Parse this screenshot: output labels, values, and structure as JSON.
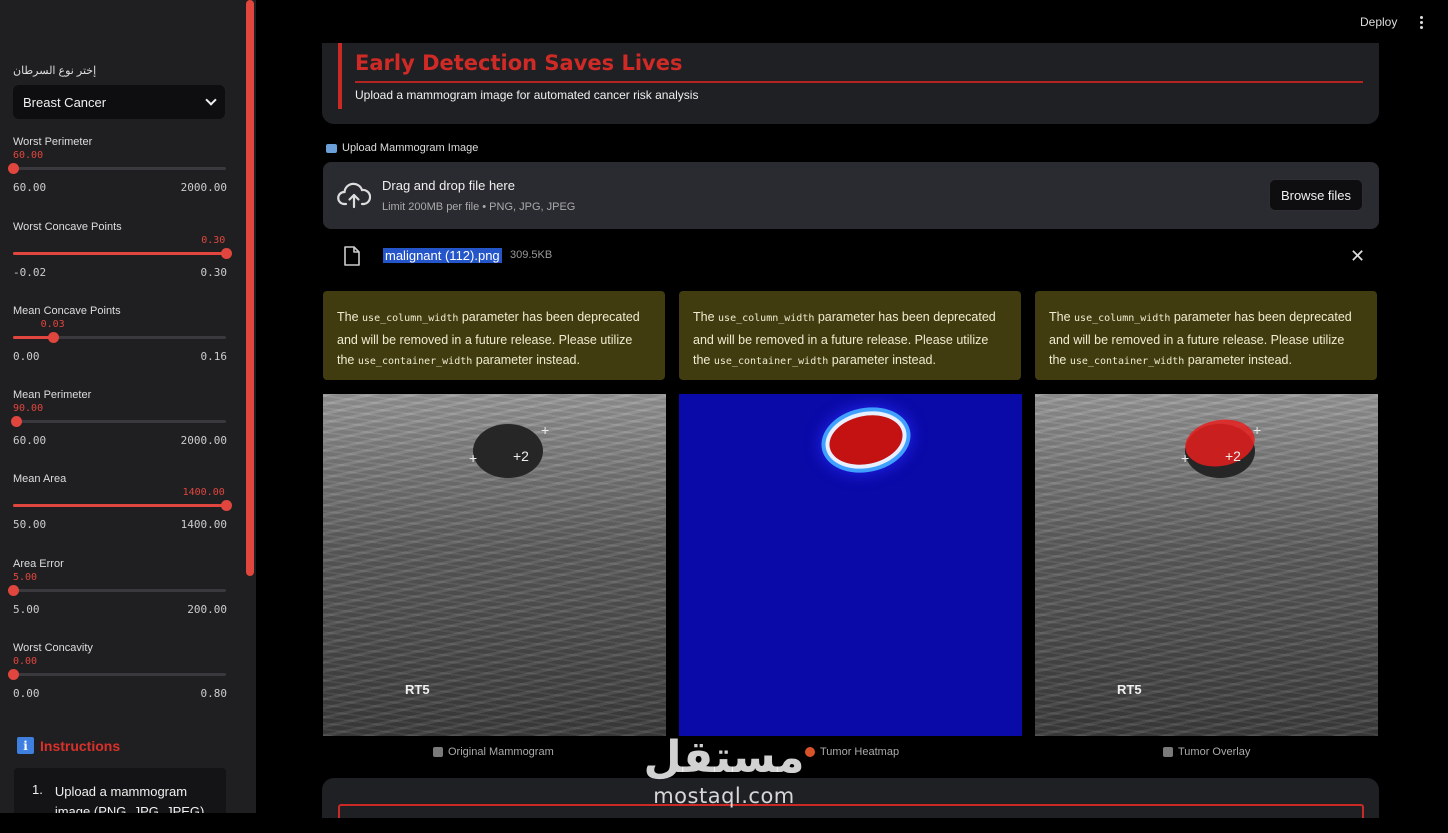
{
  "topbar": {
    "deploy_label": "Deploy"
  },
  "sidebar": {
    "cancer_type_label": "إختر نوع السرطان",
    "cancer_type_selected": "Breast Cancer",
    "sliders": [
      {
        "label": "Worst Perimeter",
        "value": "60.00",
        "min": "60.00",
        "max": "2000.00",
        "fraction": 0.0
      },
      {
        "label": "Worst Concave Points",
        "value": "0.30",
        "min": "-0.02",
        "max": "0.30",
        "fraction": 1.0
      },
      {
        "label": "Mean Concave Points",
        "value": "0.03",
        "min": "0.00",
        "max": "0.16",
        "fraction": 0.19
      },
      {
        "label": "Mean Perimeter",
        "value": "90.00",
        "min": "60.00",
        "max": "2000.00",
        "fraction": 0.015
      },
      {
        "label": "Mean Area",
        "value": "1400.00",
        "min": "50.00",
        "max": "1400.00",
        "fraction": 1.0
      },
      {
        "label": "Area Error",
        "value": "5.00",
        "min": "5.00",
        "max": "200.00",
        "fraction": 0.0
      },
      {
        "label": "Worst Concavity",
        "value": "0.00",
        "min": "0.00",
        "max": "0.80",
        "fraction": 0.0
      }
    ],
    "instructions_title": "Instructions",
    "instructions_first_num": "1.",
    "instructions_first_item": "Upload a mammogram image (PNG, JPG, JPEG)"
  },
  "hero": {
    "title": "Early Detection Saves Lives",
    "subtitle": "Upload a mammogram image for automated cancer risk analysis"
  },
  "uploader": {
    "label": "Upload Mammogram Image",
    "drag_text": "Drag and drop file here",
    "limit_text": "Limit 200MB per file • PNG, JPG, JPEG",
    "browse_label": "Browse files",
    "file_name": "malignant (112).png",
    "file_size": "309.5KB"
  },
  "warning": {
    "pre": "The",
    "param_old": "use_column_width",
    "mid": "parameter has been deprecated and will be removed in a future release. Please utilize the",
    "param_new": "use_container_width",
    "post": "parameter instead."
  },
  "images": {
    "rt_label": "RT5",
    "captions": [
      "Original Mammogram",
      "Tumor Heatmap",
      "Tumor Overlay"
    ]
  },
  "watermark": {
    "arabic": "مستقل",
    "domain": "mostaql.com"
  },
  "colors": {
    "accent": "#e0463d",
    "warning_bg": "#403c10",
    "heatmap_bg": "#0a0aa8"
  }
}
